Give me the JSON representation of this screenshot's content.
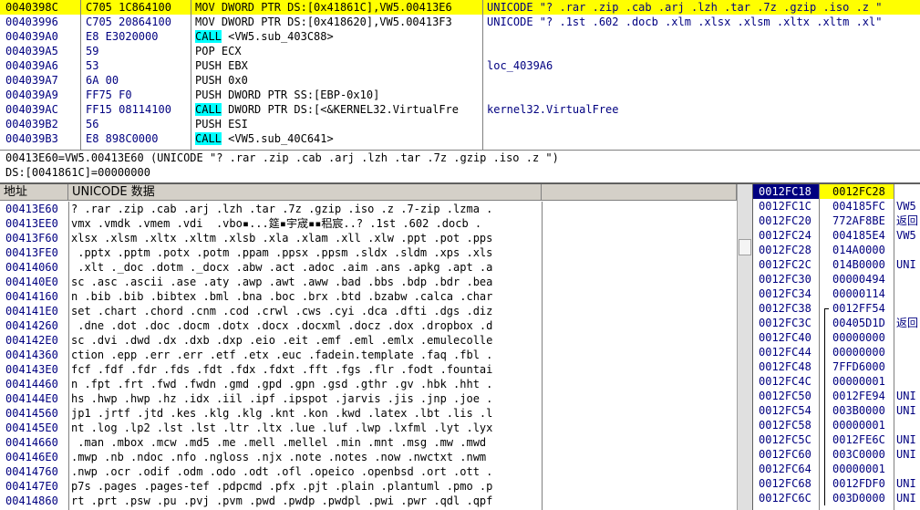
{
  "disasm": {
    "rows": [
      {
        "addr": "0040398C",
        "hex": "C705 1C864100",
        "instr": "MOV DWORD PTR DS:[0x41861C],VW5.00413E6",
        "comment": "UNICODE \"? .rar .zip .cab .arj .lzh .tar .7z .gzip .iso .z \"",
        "selected": true,
        "call": false
      },
      {
        "addr": "00403996",
        "hex": "C705 20864100",
        "instr": "MOV DWORD PTR DS:[0x418620],VW5.00413F3",
        "comment": "UNICODE \"? .1st .602 .docb .xlm .xlsx .xlsm .xltx .xltm .xl\"",
        "selected": false,
        "call": false
      },
      {
        "addr": "004039A0",
        "hex": "E8 E3020000",
        "instr": "<VW5.sub_403C88>",
        "comment": "",
        "selected": false,
        "call": true
      },
      {
        "addr": "004039A5",
        "hex": "59",
        "instr": "POP ECX",
        "comment": "",
        "selected": false,
        "call": false
      },
      {
        "addr": "004039A6",
        "hex": "53",
        "instr": "PUSH EBX",
        "comment": "loc_4039A6",
        "selected": false,
        "call": false
      },
      {
        "addr": "004039A7",
        "hex": "6A 00",
        "instr": "PUSH 0x0",
        "comment": "",
        "selected": false,
        "call": false
      },
      {
        "addr": "004039A9",
        "hex": "FF75 F0",
        "instr": "PUSH DWORD PTR SS:[EBP-0x10]",
        "comment": "",
        "selected": false,
        "call": false
      },
      {
        "addr": "004039AC",
        "hex": "FF15 08114100",
        "instr": "DWORD PTR DS:[<&KERNEL32.VirtualFre",
        "comment": "kernel32.VirtualFree",
        "selected": false,
        "call": true
      },
      {
        "addr": "004039B2",
        "hex": "56",
        "instr": "PUSH ESI",
        "comment": "",
        "selected": false,
        "call": false
      },
      {
        "addr": "004039B3",
        "hex": "E8 898C0000",
        "instr": "<VW5.sub_40C641>",
        "comment": "",
        "selected": false,
        "call": true
      }
    ],
    "call_label": "CALL"
  },
  "info": {
    "line1": "00413E60=VW5.00413E60 (UNICODE \"? .rar .zip .cab .arj .lzh .tar .7z .gzip .iso .z \")",
    "line2": "DS:[0041861C]=00000000"
  },
  "dump": {
    "col_address": "地址",
    "col_unicode": "UNICODE 数据",
    "rows": [
      {
        "addr": "00413E60",
        "text": "? .rar .zip .cab .arj .lzh .tar .7z .gzip .iso .z .7-zip .lzma ."
      },
      {
        "addr": "00413EE0",
        "text": "vmx .vmdk .vmem .vdi  .vbo▪...筵▪宇宬▪▪稆宸..? .1st .602 .docb ."
      },
      {
        "addr": "00413F60",
        "text": "xlsx .xlsm .xltx .xltm .xlsb .xla .xlam .xll .xlw .ppt .pot .pps"
      },
      {
        "addr": "00413FE0",
        "text": " .pptx .pptm .potx .potm .ppam .ppsx .ppsm .sldx .sldm .xps .xls"
      },
      {
        "addr": "00414060",
        "text": " .xlt ._doc .dotm ._docx .abw .act .adoc .aim .ans .apkg .apt .a"
      },
      {
        "addr": "004140E0",
        "text": "sc .asc .ascii .ase .aty .awp .awt .aww .bad .bbs .bdp .bdr .bea"
      },
      {
        "addr": "00414160",
        "text": "n .bib .bib .bibtex .bml .bna .boc .brx .btd .bzabw .calca .char"
      },
      {
        "addr": "004141E0",
        "text": "set .chart .chord .cnm .cod .crwl .cws .cyi .dca .dfti .dgs .diz"
      },
      {
        "addr": "00414260",
        "text": " .dne .dot .doc .docm .dotx .docx .docxml .docz .dox .dropbox .d"
      },
      {
        "addr": "004142E0",
        "text": "sc .dvi .dwd .dx .dxb .dxp .eio .eit .emf .eml .emlx .emulecolle"
      },
      {
        "addr": "00414360",
        "text": "ction .epp .err .err .etf .etx .euc .fadein.template .faq .fbl ."
      },
      {
        "addr": "004143E0",
        "text": "fcf .fdf .fdr .fds .fdt .fdx .fdxt .fft .fgs .flr .fodt .fountai"
      },
      {
        "addr": "00414460",
        "text": "n .fpt .frt .fwd .fwdn .gmd .gpd .gpn .gsd .gthr .gv .hbk .hht ."
      },
      {
        "addr": "004144E0",
        "text": "hs .hwp .hwp .hz .idx .iil .ipf .ipspot .jarvis .jis .jnp .joe ."
      },
      {
        "addr": "00414560",
        "text": "jp1 .jrtf .jtd .kes .klg .klg .knt .kon .kwd .latex .lbt .lis .l"
      },
      {
        "addr": "004145E0",
        "text": "nt .log .lp2 .lst .lst .ltr .ltx .lue .luf .lwp .lxfml .lyt .lyx"
      },
      {
        "addr": "00414660",
        "text": " .man .mbox .mcw .md5 .me .mell .mellel .min .mnt .msg .mw .mwd"
      },
      {
        "addr": "004146E0",
        "text": ".mwp .nb .ndoc .nfo .ngloss .njx .note .notes .now .nwctxt .nwm"
      },
      {
        "addr": "00414760",
        "text": ".nwp .ocr .odif .odm .odo .odt .ofl .opeico .openbsd .ort .ott ."
      },
      {
        "addr": "004147E0",
        "text": "p7s .pages .pages-tef .pdpcmd .pfx .pjt .plain .plantuml .pmo .p"
      },
      {
        "addr": "00414860",
        "text": "rt .prt .psw .pu .pvj .pvm .pwd .pwdp .pwdpl .pwi .pwr .qdl .qpf"
      }
    ]
  },
  "stack": {
    "rows": [
      {
        "addr": "0012FC18",
        "val": "0012FC28",
        "note": "",
        "selected": true,
        "bracket": ""
      },
      {
        "addr": "0012FC1C",
        "val": "004185FC",
        "note": "VW5",
        "selected": false,
        "bracket": ""
      },
      {
        "addr": "0012FC20",
        "val": "772AF8BE",
        "note": "返回",
        "selected": false,
        "bracket": ""
      },
      {
        "addr": "0012FC24",
        "val": "004185E4",
        "note": "VW5",
        "selected": false,
        "bracket": ""
      },
      {
        "addr": "0012FC28",
        "val": "014A0000",
        "note": "",
        "selected": false,
        "bracket": ""
      },
      {
        "addr": "0012FC2C",
        "val": "014B0000",
        "note": "UNI",
        "selected": false,
        "bracket": ""
      },
      {
        "addr": "0012FC30",
        "val": "00000494",
        "note": "",
        "selected": false,
        "bracket": ""
      },
      {
        "addr": "0012FC34",
        "val": "00000114",
        "note": "",
        "selected": false,
        "bracket": ""
      },
      {
        "addr": "0012FC38",
        "val": "0012FF54",
        "note": "",
        "selected": false,
        "bracket": "top"
      },
      {
        "addr": "0012FC3C",
        "val": "00405D1D",
        "note": "返回",
        "selected": false,
        "bracket": "mid"
      },
      {
        "addr": "0012FC40",
        "val": "00000000",
        "note": "",
        "selected": false,
        "bracket": "mid"
      },
      {
        "addr": "0012FC44",
        "val": "00000000",
        "note": "",
        "selected": false,
        "bracket": "mid"
      },
      {
        "addr": "0012FC48",
        "val": "7FFD6000",
        "note": "",
        "selected": false,
        "bracket": "mid"
      },
      {
        "addr": "0012FC4C",
        "val": "00000001",
        "note": "",
        "selected": false,
        "bracket": "mid"
      },
      {
        "addr": "0012FC50",
        "val": "0012FE94",
        "note": "UNI",
        "selected": false,
        "bracket": "mid"
      },
      {
        "addr": "0012FC54",
        "val": "003B0000",
        "note": "UNI",
        "selected": false,
        "bracket": "mid"
      },
      {
        "addr": "0012FC58",
        "val": "00000001",
        "note": "",
        "selected": false,
        "bracket": "mid"
      },
      {
        "addr": "0012FC5C",
        "val": "0012FE6C",
        "note": "UNI",
        "selected": false,
        "bracket": "mid"
      },
      {
        "addr": "0012FC60",
        "val": "003C0000",
        "note": "UNI",
        "selected": false,
        "bracket": "mid"
      },
      {
        "addr": "0012FC64",
        "val": "00000001",
        "note": "",
        "selected": false,
        "bracket": "mid"
      },
      {
        "addr": "0012FC68",
        "val": "0012FDF0",
        "note": "UNI",
        "selected": false,
        "bracket": "mid"
      },
      {
        "addr": "0012FC6C",
        "val": "003D0000",
        "note": "UNI",
        "selected": false,
        "bracket": "mid"
      }
    ]
  }
}
